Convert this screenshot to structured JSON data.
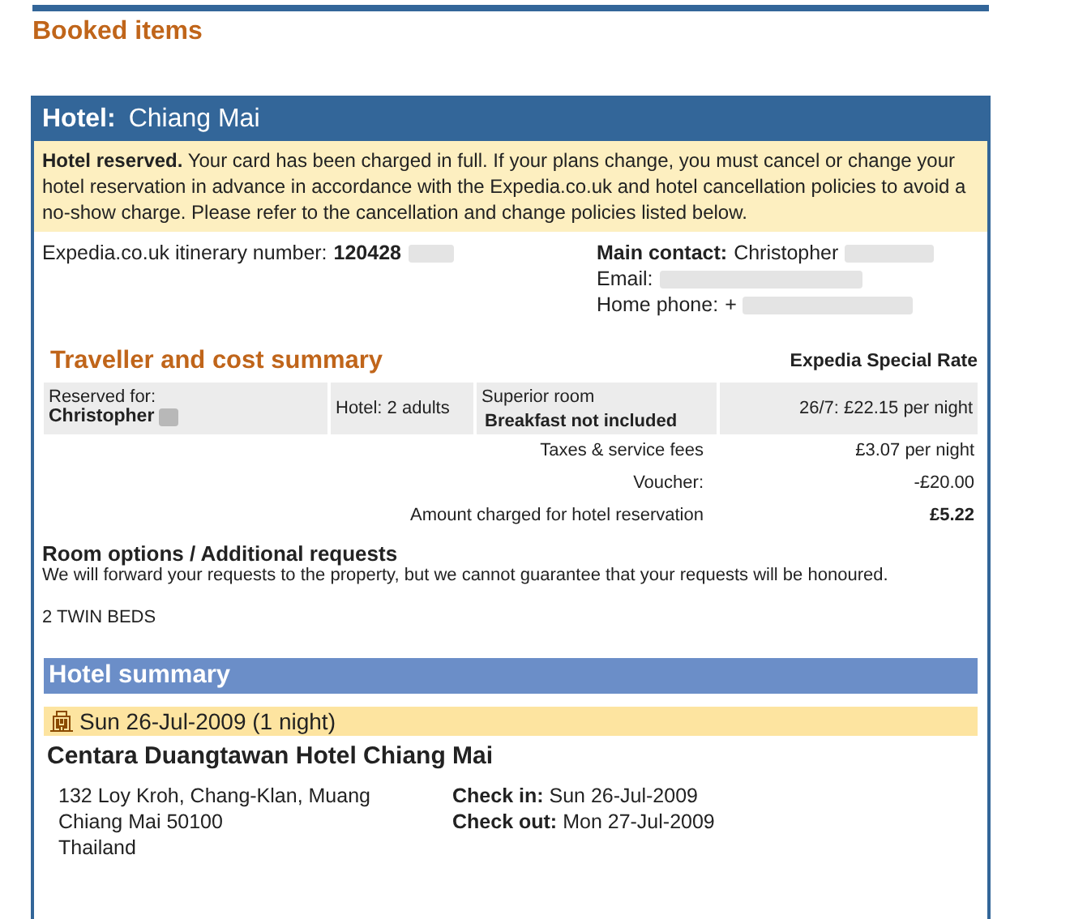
{
  "page_title": "Booked items",
  "hotel_card": {
    "label": "Hotel:",
    "city": "Chiang Mai",
    "notice": "**Hotel reserved.**   Your card has been charged in full. If your plans change, you must cancel or change your hotel reservation in advance in accordance with the Expedia.co.uk and hotel cancellation policies to avoid a no-show charge. Please refer to the cancellation and change policies listed below.",
    "itinerary": {
      "label": "Expedia.co.uk itinerary number:",
      "value": "120428"
    },
    "contact": {
      "main_label": "Main contact:",
      "main_value": "Christopher",
      "email_label": "Email:",
      "phone_label": "Home phone:",
      "phone_value": "+"
    },
    "cost_summary": {
      "title": "Traveller and cost summary",
      "rate_name": "Expedia Special Rate",
      "reserved_label": "Reserved for:",
      "reserved_name": "Christopher",
      "guests": "Hotel: 2 adults",
      "room": "Superior room",
      "room_note": "Breakfast not included",
      "nightly": "26/7: £22.15 per night",
      "lines": [
        {
          "label": "Taxes & service fees",
          "value": "£3.07 per night",
          "total": false
        },
        {
          "label": "Voucher:",
          "value": "-£20.00",
          "total": false
        },
        {
          "label": "Amount charged for hotel reservation",
          "value": "£5.22",
          "total": true
        }
      ]
    },
    "requests": {
      "title": "Room options / Additional requests",
      "note": "We will forward your requests to the property, but we cannot guarantee that your requests will be honoured.",
      "value": "2 TWIN BEDS"
    },
    "summary": {
      "title": "Hotel summary",
      "stay": "Sun 26-Jul-2009 (1 night)",
      "hotel_name": "Centara Duangtawan Hotel Chiang Mai",
      "address": [
        "132 Loy Kroh, Chang-Klan, Muang",
        "Chiang Mai 50100",
        "Thailand"
      ],
      "check_in_label": "Check in:",
      "check_in": "Sun 26-Jul-2009",
      "check_out_label": "Check out:",
      "check_out": "Mon 27-Jul-2009"
    }
  }
}
